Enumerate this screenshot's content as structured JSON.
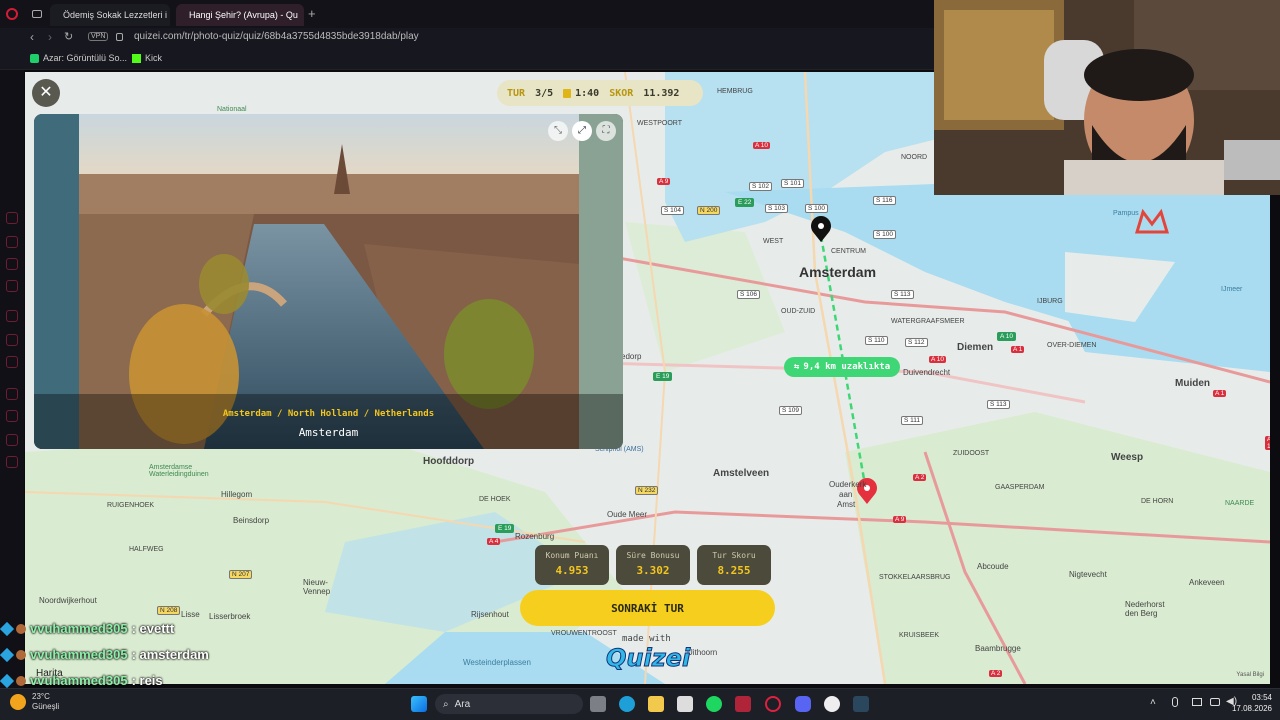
{
  "browser": {
    "tabs": [
      {
        "label": "Ödemiş Sokak Lezzetleri i"
      },
      {
        "label": "Hangi Şehir? (Avrupa) - Qu"
      }
    ],
    "vpn": "VPN",
    "url": "quizei.com/tr/photo-quiz/quiz/68b4a3755d4835bde3918dab/play",
    "bookmarks": [
      {
        "label": "Azar: Görüntülü So..."
      },
      {
        "label": "Kick"
      }
    ]
  },
  "hud": {
    "round_label": "TUR",
    "round_value": "3/5",
    "timer": "1:40",
    "score_label": "SKOR",
    "score_value": "11.392"
  },
  "photo": {
    "location_path": "Amsterdam / North Holland / Netherlands",
    "city": "Amsterdam"
  },
  "results": {
    "distance": "9,4 km uzaklıkta",
    "boxes": [
      {
        "label": "Konum Puanı",
        "value": "4.953"
      },
      {
        "label": "Süre Bonusu",
        "value": "3.302"
      },
      {
        "label": "Tur Skoru",
        "value": "8.255"
      }
    ],
    "next_button": "SONRAKİ TUR",
    "made_with": "made with",
    "brand": "Quizei"
  },
  "map": {
    "attribution": "Yasal Bilgi",
    "labels": {
      "hembrug": "HEMBRUG",
      "westpoort": "WESTPOORT",
      "noord": "NOORD",
      "nationaal": "Nationaal",
      "west": "WEST",
      "centrum": "CENTRUM",
      "amsterdam": "Amsterdam",
      "oud_zuid": "OUD-ZUID",
      "watergraafsmeer": "WATERGRAAFSMEER",
      "diemen": "Diemen",
      "over_diemen": "OVER-DIEMEN",
      "ijburg": "IJBURG",
      "ijmeer": "IJmeer",
      "pampus": "Pampus",
      "muiden": "Muiden",
      "duivendrecht": "Duivendrecht",
      "edorp": "edorp",
      "schiphol": "Schiphol (AMS)",
      "hoofddorp": "Hoofddorp",
      "amstelveen": "Amstelveen",
      "ouderkerk": "Ouderkerk",
      "aan": "aan",
      "amst": "Amst",
      "zuidoost": "ZUIDOOST",
      "gaasperdam": "GAASPERDAM",
      "weesp": "Weesp",
      "de_horn": "DE HORN",
      "naarde": "NAARDE",
      "hillegom": "Hillegom",
      "beinsdorp": "Beinsdorp",
      "ruigenhoek": "RUIGENHOEK",
      "halfweg": "HALFWEG",
      "de_hoek": "DE HOEK",
      "rozenburg": "Rozenburg",
      "oude_meer": "Oude Meer",
      "waterleiding": "Amsterdamse Waterleidingduinen",
      "nieuw_vennep": "Nieuw-\nVennep",
      "noordwijkerhout": "Noordwijkerhout",
      "lisse": "Lisse",
      "lisserbroek": "Lisserbroek",
      "rijsenhout": "Rijsenhout",
      "vrouwentroost": "VROUWENTROOST",
      "uithoorn": "Uithoorn",
      "westeinder": "Westeinderplassen",
      "stokkelaarsbrug": "STOKKELAARSBRUG",
      "abcoude": "Abcoude",
      "nigtevecht": "Nigtevecht",
      "ankeveen": "Ankeveen",
      "nederhorst": "Nederhorst\nden Berg",
      "baambrugge": "Baambrugge",
      "kruisbeek": "KRUISBEEK",
      "harita": "Harita"
    },
    "shields": [
      "S 102",
      "S 101",
      "S 103",
      "S 100",
      "S 116",
      "S 104",
      "N 200",
      "S 100",
      "S 106",
      "S 113",
      "S 110",
      "S 112",
      "S 109",
      "S 111",
      "S 113",
      "N 232",
      "N 207",
      "N 208",
      "A 10",
      "A 9",
      "A 10",
      "A 1",
      "A 2",
      "A 9",
      "A 2",
      "A 4",
      "A 1",
      "A 1",
      "E 22",
      "E 19",
      "E 19",
      "A 10",
      "A 2"
    ]
  },
  "chat": [
    {
      "user": "vvuhammed305",
      "message": ": evettt"
    },
    {
      "user": "vvuhammed305",
      "message": ": amsterdam"
    },
    {
      "user": "vvuhammed305",
      "message": ": reis"
    }
  ],
  "taskbar": {
    "weather_temp": "23°C",
    "weather_desc": "Güneşli",
    "search": "Ara",
    "time": "03:54",
    "date": "17.08.2026"
  },
  "colors": {
    "accent": "#f6cf1e",
    "distance_badge": "#3fd776",
    "map_water": "#a9dcf0",
    "map_green": "#d4ecc6"
  }
}
